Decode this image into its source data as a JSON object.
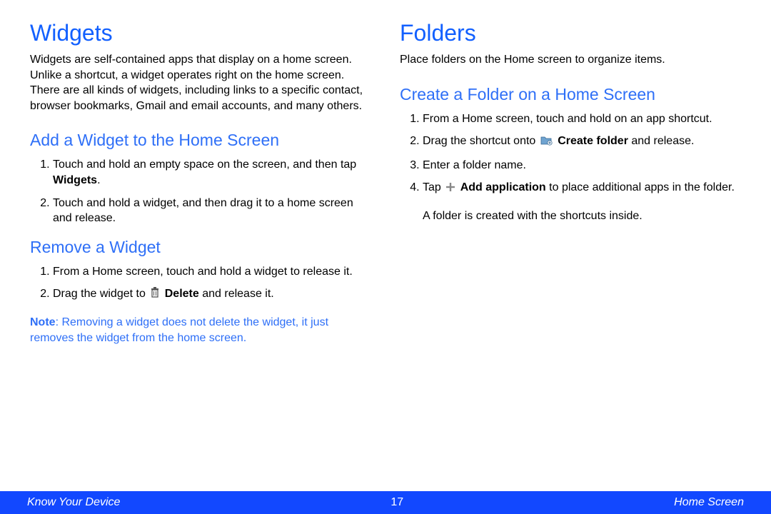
{
  "left": {
    "h1": "Widgets",
    "intro": "Widgets are self-contained apps that display on a home screen. Unlike a shortcut, a widget operates right on the home screen. There are all kinds of widgets, including links to a specific contact, browser bookmarks, Gmail and email accounts, and many others.",
    "add": {
      "h2": "Add a Widget to the Home Screen",
      "step1_a": "Touch and hold an empty space on the screen, and then tap ",
      "step1_b": "Widgets",
      "step1_c": ".",
      "step2": "Touch and hold a widget, and then drag it to a home screen and release."
    },
    "remove": {
      "h2": "Remove a Widget",
      "step1": "From a Home screen, touch and hold a widget to release it.",
      "step2_a": "Drag the widget to ",
      "step2_b": "Delete",
      "step2_c": " and release it.",
      "note_label": "Note",
      "note_text": ": Removing a widget does not delete the widget, it just removes the widget from the home screen."
    }
  },
  "right": {
    "h1": "Folders",
    "intro": "Place folders on the Home screen to organize items.",
    "create": {
      "h2": "Create a Folder on a Home Screen",
      "step1": "From a Home screen, touch and hold on an app shortcut.",
      "step2_a": "Drag the shortcut onto ",
      "step2_b": "Create folder",
      "step2_c": " and release.",
      "step3": "Enter a folder name.",
      "step4_a": "Tap ",
      "step4_b": "Add application",
      "step4_c": " to place additional apps in the folder.",
      "after": "A folder is created with the shortcuts inside."
    }
  },
  "footer": {
    "left": "Know Your Device",
    "center": "17",
    "right": "Home Screen"
  }
}
